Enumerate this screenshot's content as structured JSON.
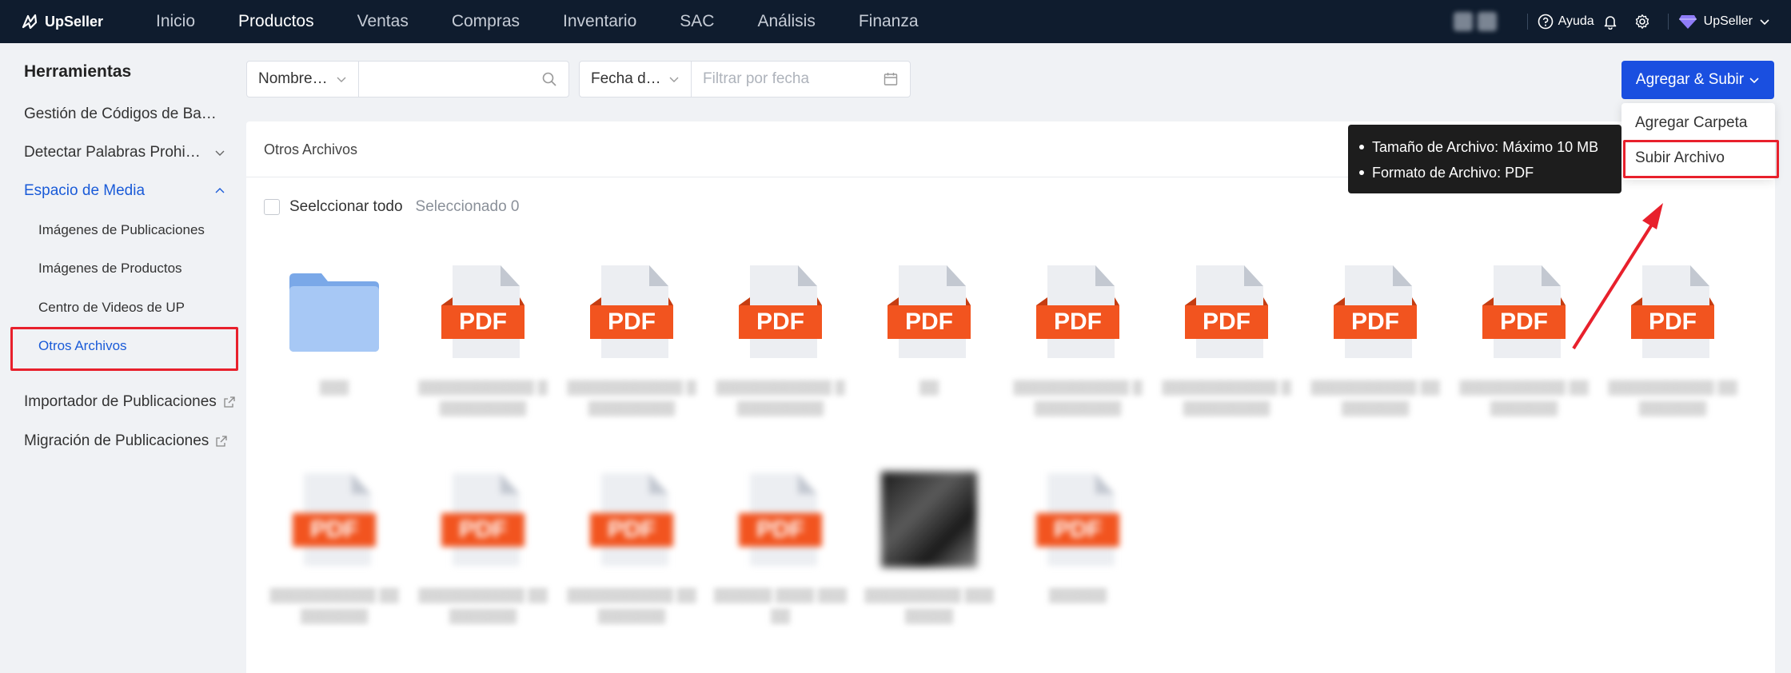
{
  "header": {
    "brand": "UpSeller",
    "nav": [
      "Inicio",
      "Productos",
      "Ventas",
      "Compras",
      "Inventario",
      "SAC",
      "Análisis",
      "Finanza"
    ],
    "active_nav": "Productos",
    "help_label": "Ayuda",
    "user_label": "UpSeller"
  },
  "sidebar": {
    "title": "Herramientas",
    "items": {
      "barcodes": "Gestión de Códigos de Ba…",
      "forbidden_words": "Detectar Palabras Prohi…",
      "media_space": "Espacio de Media",
      "listing_importer": "Importador de Publicaciones",
      "listing_migration": "Migración de Publicaciones"
    },
    "media_sub": {
      "listing_images": "Imágenes de Publicaciones",
      "product_images": "Imágenes de Productos",
      "video_center": "Centro de Videos de UP",
      "other_files": "Otros Archivos"
    }
  },
  "filters": {
    "name_select": "Nombre…",
    "search_placeholder": "",
    "date_select": "Fecha d…",
    "date_placeholder": "Filtrar por fecha"
  },
  "actions": {
    "add_upload_label": "Agregar & Subir",
    "dropdown": {
      "add_folder": "Agregar Carpeta",
      "upload_file": "Subir Archivo"
    }
  },
  "tooltip": {
    "line1": "Tamaño de Archivo: Máximo 10 MB",
    "line2": "Formato de Archivo: PDF"
  },
  "panel": {
    "title": "Otros Archivos",
    "select_all": "Seelccionar todo",
    "selected_count": "Seleccionado 0"
  },
  "files": {
    "pdf_label": "PDF"
  },
  "colors": {
    "topbar": "#0f1c2e",
    "accent": "#1a5bd8",
    "primary_button": "#1a4fe0",
    "pdf_orange": "#f2541f",
    "highlight_red": "#e8202c"
  }
}
